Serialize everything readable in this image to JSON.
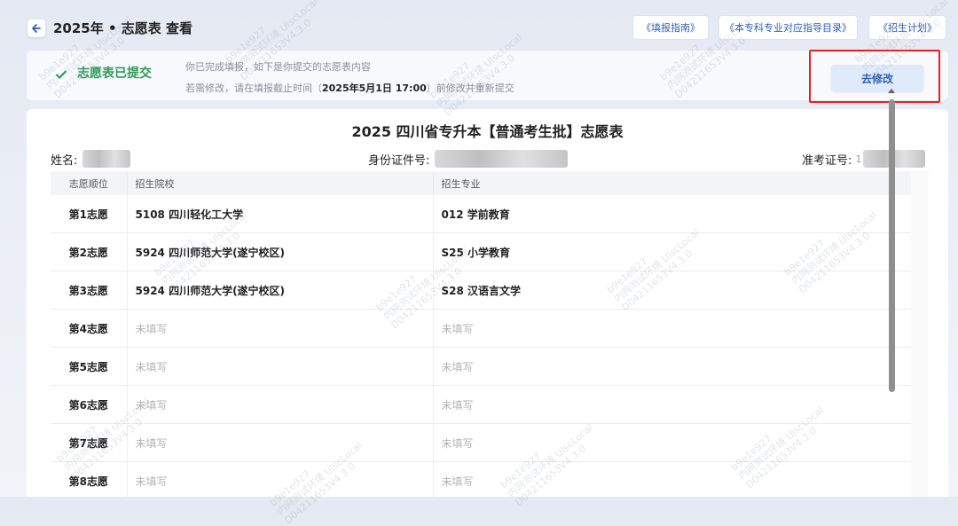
{
  "header": {
    "title": "2025年 • 志愿表 查看",
    "links": [
      "《填报指南》",
      "《本专科专业对应指导目录》",
      "《招生计划》"
    ]
  },
  "banner": {
    "status": "志愿表已提交",
    "line1": "你已完成填报，如下是你提交的志愿表内容",
    "line2_before": "若需修改，请在填报截止时间（",
    "deadline": "2025年5月1日 17:00",
    "line2_after": "）前修改并重新提交",
    "button": "去修改"
  },
  "form": {
    "title": "2025 四川省专升本【普通考生批】志愿表",
    "name_label": "姓名:",
    "id_label": "身份证件号:",
    "exam_label": "准考证号:",
    "exam_prefix": "1"
  },
  "table": {
    "headers": [
      "志愿顺位",
      "招生院校",
      "招生专业"
    ],
    "rows": [
      {
        "rank": "第1志愿",
        "school": "5108 四川轻化工大学",
        "major": "012 学前教育",
        "filled": true
      },
      {
        "rank": "第2志愿",
        "school": "5924 四川师范大学(遂宁校区)",
        "major": "S25 小学教育",
        "filled": true
      },
      {
        "rank": "第3志愿",
        "school": "5924 四川师范大学(遂宁校区)",
        "major": "S28 汉语言文学",
        "filled": true
      },
      {
        "rank": "第4志愿",
        "school": "未填写",
        "major": "未填写",
        "filled": false
      },
      {
        "rank": "第5志愿",
        "school": "未填写",
        "major": "未填写",
        "filled": false
      },
      {
        "rank": "第6志愿",
        "school": "未填写",
        "major": "未填写",
        "filled": false
      },
      {
        "rank": "第7志愿",
        "school": "未填写",
        "major": "未填写",
        "filled": false
      },
      {
        "rank": "第8志愿",
        "school": "未填写",
        "major": "未填写",
        "filled": false
      }
    ]
  },
  "watermark": {
    "line1": "内网测试环境 UlscLocal",
    "line2": "D04211653V4.3.0",
    "tag": "b9e1e927"
  },
  "colors": {
    "accent": "#2f5fb3",
    "success": "#2f9a55",
    "highlight": "#e8201c"
  }
}
